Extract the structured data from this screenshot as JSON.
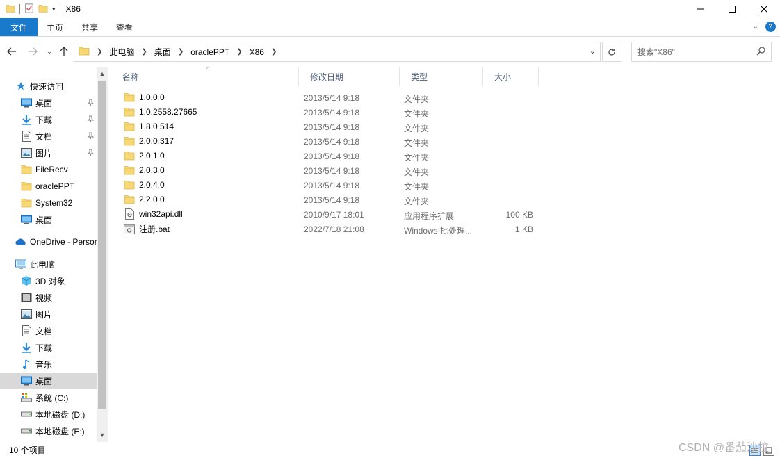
{
  "window": {
    "title": "X86"
  },
  "ribbon": {
    "tabs": [
      "文件",
      "主页",
      "共享",
      "查看"
    ]
  },
  "address": {
    "crumbs": [
      "此电脑",
      "桌面",
      "oraclePPT",
      "X86"
    ]
  },
  "search": {
    "placeholder": "搜索\"X86\""
  },
  "nav": {
    "items": [
      {
        "label": "快速访问",
        "icon": "star-icon",
        "pinned": false
      },
      {
        "label": "桌面",
        "icon": "desktop-icon",
        "pinned": true
      },
      {
        "label": "下载",
        "icon": "download-icon",
        "pinned": true
      },
      {
        "label": "文档",
        "icon": "document-icon",
        "pinned": true
      },
      {
        "label": "图片",
        "icon": "picture-icon",
        "pinned": true
      },
      {
        "label": "FileRecv",
        "icon": "folder-icon",
        "pinned": false
      },
      {
        "label": "oraclePPT",
        "icon": "folder-icon",
        "pinned": false
      },
      {
        "label": "System32",
        "icon": "folder-icon",
        "pinned": false
      },
      {
        "label": "桌面",
        "icon": "desktop-icon",
        "pinned": false
      },
      {
        "label": "OneDrive - Personal",
        "icon": "cloud-icon",
        "pinned": false
      },
      {
        "label": "此电脑",
        "icon": "computer-icon",
        "pinned": false
      },
      {
        "label": "3D 对象",
        "icon": "cube-icon",
        "pinned": false
      },
      {
        "label": "视频",
        "icon": "video-icon",
        "pinned": false
      },
      {
        "label": "图片",
        "icon": "picture-icon",
        "pinned": false
      },
      {
        "label": "文档",
        "icon": "document-icon",
        "pinned": false
      },
      {
        "label": "下载",
        "icon": "download-icon",
        "pinned": false
      },
      {
        "label": "音乐",
        "icon": "music-icon",
        "pinned": false
      },
      {
        "label": "桌面",
        "icon": "desktop-icon",
        "pinned": false,
        "selected": true
      },
      {
        "label": "系统 (C:)",
        "icon": "system-drive-icon",
        "pinned": false
      },
      {
        "label": "本地磁盘 (D:)",
        "icon": "drive-icon",
        "pinned": false
      },
      {
        "label": "本地磁盘 (E:)",
        "icon": "drive-icon",
        "pinned": false
      }
    ]
  },
  "columns": {
    "name": "名称",
    "date": "修改日期",
    "type": "类型",
    "size": "大小"
  },
  "files": [
    {
      "name": "1.0.0.0",
      "date": "2013/5/14 9:18",
      "type": "文件夹",
      "size": "",
      "icon": "folder-icon"
    },
    {
      "name": "1.0.2558.27665",
      "date": "2013/5/14 9:18",
      "type": "文件夹",
      "size": "",
      "icon": "folder-icon"
    },
    {
      "name": "1.8.0.514",
      "date": "2013/5/14 9:18",
      "type": "文件夹",
      "size": "",
      "icon": "folder-icon"
    },
    {
      "name": "2.0.0.317",
      "date": "2013/5/14 9:18",
      "type": "文件夹",
      "size": "",
      "icon": "folder-icon"
    },
    {
      "name": "2.0.1.0",
      "date": "2013/5/14 9:18",
      "type": "文件夹",
      "size": "",
      "icon": "folder-icon"
    },
    {
      "name": "2.0.3.0",
      "date": "2013/5/14 9:18",
      "type": "文件夹",
      "size": "",
      "icon": "folder-icon"
    },
    {
      "name": "2.0.4.0",
      "date": "2013/5/14 9:18",
      "type": "文件夹",
      "size": "",
      "icon": "folder-icon"
    },
    {
      "name": "2.2.0.0",
      "date": "2013/5/14 9:18",
      "type": "文件夹",
      "size": "",
      "icon": "folder-icon"
    },
    {
      "name": "win32api.dll",
      "date": "2010/9/17 18:01",
      "type": "应用程序扩展",
      "size": "100 KB",
      "icon": "dll-file-icon"
    },
    {
      "name": "注册.bat",
      "date": "2022/7/18 21:08",
      "type": "Windows 批处理...",
      "size": "1 KB",
      "icon": "batch-file-icon"
    }
  ],
  "status": {
    "count": "10 个项目"
  },
  "watermark": "CSDN @番茄沙拉",
  "colors": {
    "accent": "#1979ca",
    "folder": "#f8d775",
    "selected": "#d9d9d9"
  }
}
